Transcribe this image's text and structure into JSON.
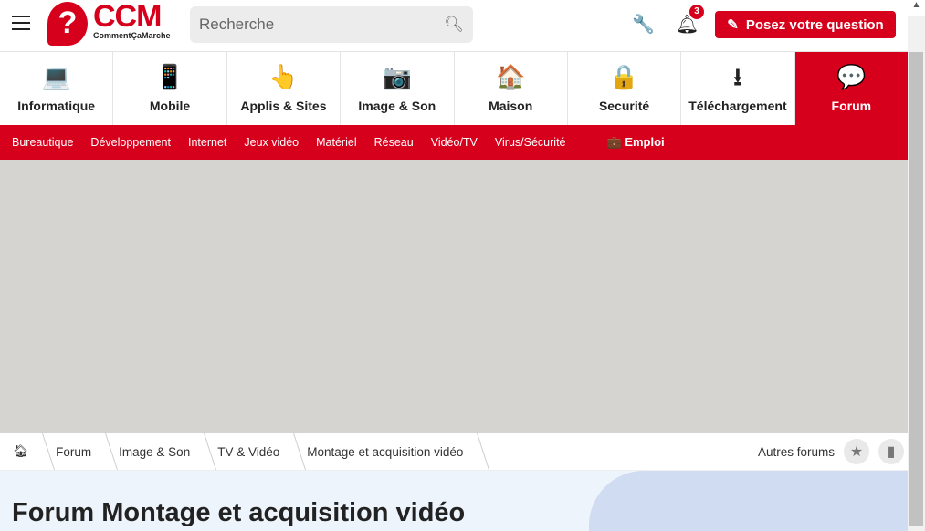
{
  "header": {
    "logo_text": "CCM",
    "logo_sub": "CommentÇaMarche",
    "search_placeholder": "Recherche",
    "notification_count": "3",
    "ask_label": "Posez votre question"
  },
  "nav": [
    {
      "label": "Informatique",
      "icon": "💻"
    },
    {
      "label": "Mobile",
      "icon": "📱"
    },
    {
      "label": "Applis & Sites",
      "icon": "👆"
    },
    {
      "label": "Image & Son",
      "icon": "📷"
    },
    {
      "label": "Maison",
      "icon": "🏠"
    },
    {
      "label": "Securité",
      "icon": "🔒"
    },
    {
      "label": "Téléchargement",
      "icon": "⭳"
    },
    {
      "label": "Forum",
      "icon": "💬"
    }
  ],
  "subnav": [
    "Bureautique",
    "Développement",
    "Internet",
    "Jeux vidéo",
    "Matériel",
    "Réseau",
    "Vidéo/TV",
    "Virus/Sécurité"
  ],
  "job_label": "Emploi",
  "breadcrumb": [
    "Forum",
    "Image & Son",
    "TV & Vidéo",
    "Montage et acquisition vidéo"
  ],
  "other_forums": "Autres forums",
  "title": "Forum Montage et acquisition vidéo",
  "colors": {
    "brand": "#d6001c"
  }
}
